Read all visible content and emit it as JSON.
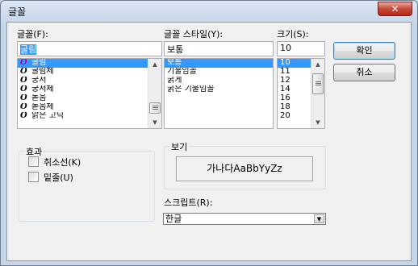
{
  "window": {
    "title": "글꼴",
    "close_glyph": "✕"
  },
  "font": {
    "label": "글꼴(F):",
    "value": "굴림",
    "items": [
      "굴림",
      "굴림체",
      "궁서",
      "궁서체",
      "돋움",
      "돋움체",
      "맑은 고딕"
    ],
    "selected_index": 0,
    "icon_glyph": "O"
  },
  "style": {
    "label": "글꼴 스타일(Y):",
    "value": "보통",
    "items": [
      "보통",
      "기울임꼴",
      "굵게",
      "굵은 기울임꼴"
    ],
    "selected_index": 0
  },
  "size": {
    "label": "크기(S):",
    "value": "10",
    "items": [
      "10",
      "11",
      "12",
      "14",
      "16",
      "18",
      "20"
    ],
    "selected_index": 0
  },
  "buttons": {
    "ok": "확인",
    "cancel": "취소"
  },
  "effects": {
    "title": "효과",
    "strikeout": {
      "label": "취소선(K)",
      "checked": false
    },
    "underline": {
      "label": "밑줄(U)",
      "checked": false
    }
  },
  "preview": {
    "title": "보기",
    "sample": "가나다AaBbYyZz"
  },
  "script": {
    "label": "스크립트(R):",
    "value": "한글",
    "arrow_glyph": "▼"
  },
  "scroll_glyphs": {
    "up": "▲",
    "down": "▼"
  }
}
